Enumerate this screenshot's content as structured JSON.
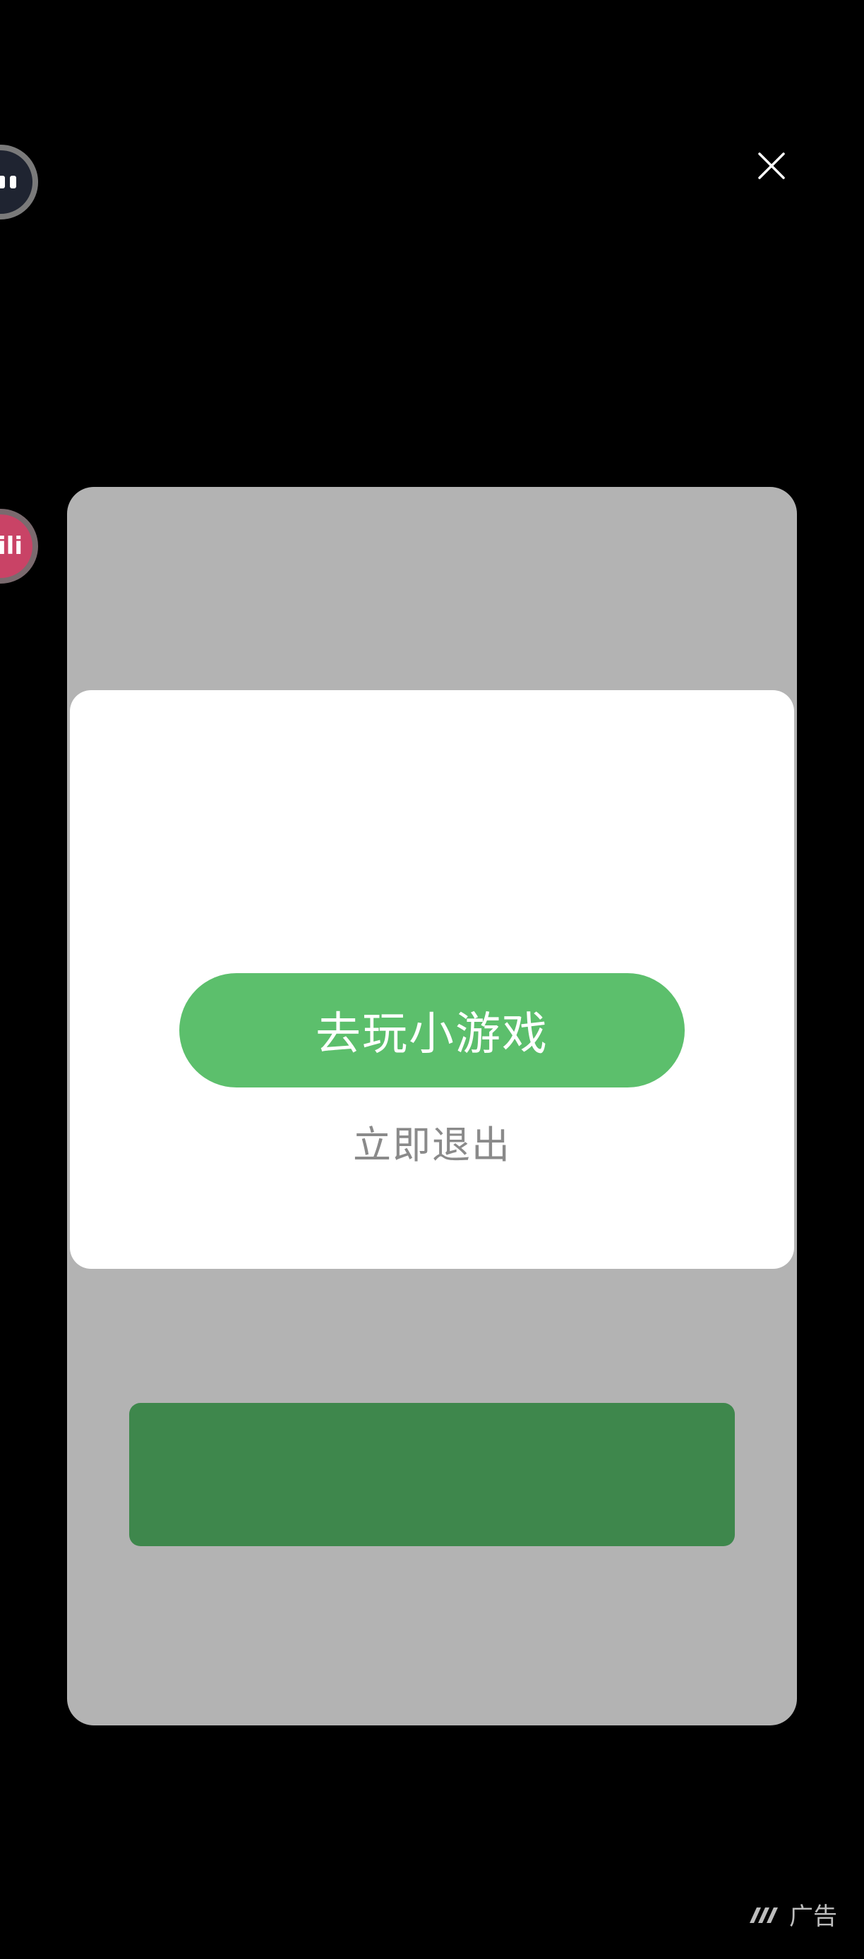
{
  "dialog": {
    "primary_label": "去玩小游戏",
    "secondary_label": "立即退出"
  },
  "ad_tag": {
    "label": "广告"
  },
  "side_icons": {
    "pink_label": "ili"
  },
  "icons": {
    "close": "close-icon",
    "ad_logo": "ad-logo-icon"
  },
  "colors": {
    "background": "#000000",
    "card": "#b3b3b3",
    "dialog": "#ffffff",
    "primary_button": "#5cbf6c",
    "ad_bar": "#3e874c",
    "secondary_text": "#8a8a8a"
  }
}
